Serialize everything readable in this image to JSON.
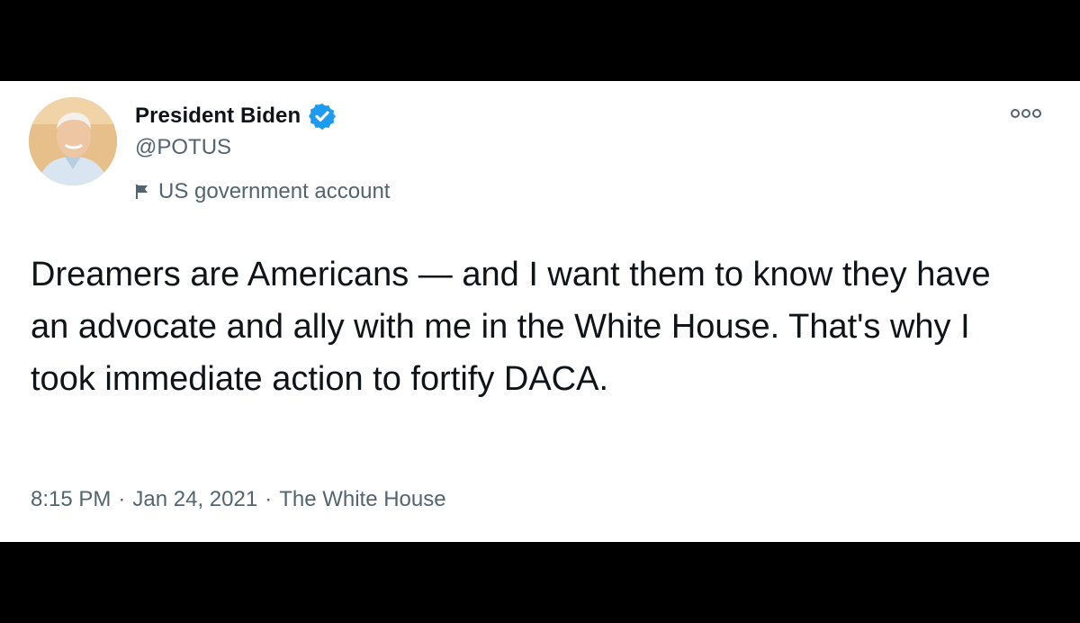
{
  "tweet": {
    "author_name": "President Biden",
    "handle": "@POTUS",
    "account_label": "US government account",
    "text": "Dreamers are Americans — and I want them to know they have an advocate and ally with me in the White House. That's why I took immediate action to fortify DACA.",
    "time": "8:15 PM",
    "date": "Jan 24, 2021",
    "source": "The White House",
    "separator": "·"
  },
  "icons": {
    "verified": "verified-badge-icon",
    "label": "flag-icon",
    "more": "more-options-icon"
  },
  "colors": {
    "background": "#000000",
    "card": "#ffffff",
    "text_primary": "#0f1419",
    "text_secondary": "#536471",
    "verified_blue": "#1d9bf0"
  }
}
